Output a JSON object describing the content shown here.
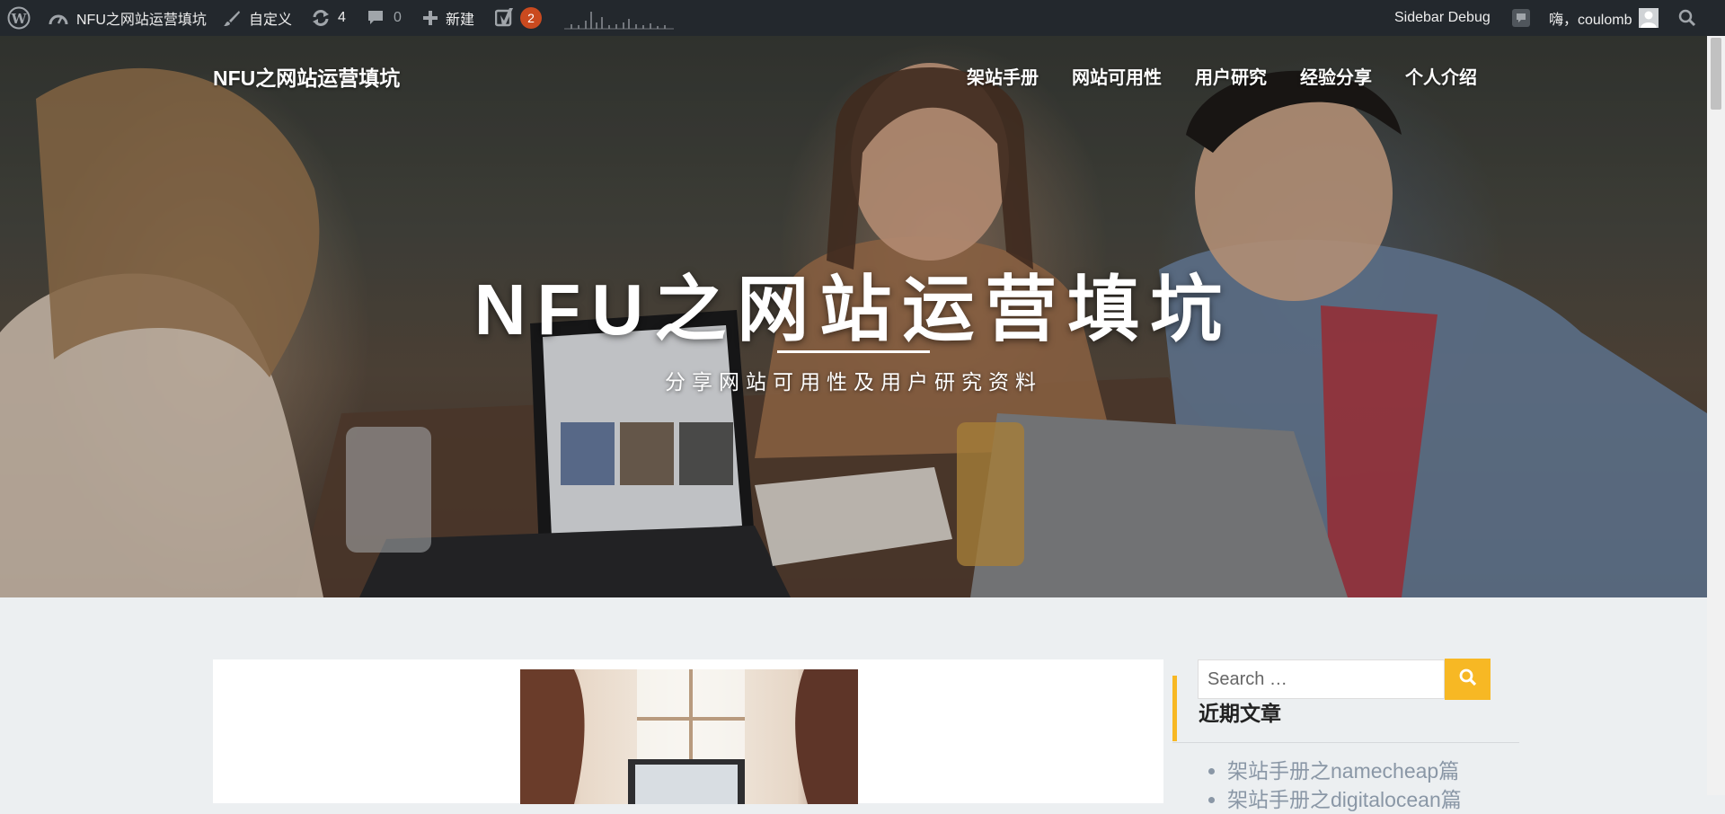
{
  "adminbar": {
    "site_name": "NFU之网站运营填坑",
    "customize": "自定义",
    "updates_count": "4",
    "comments_count": "0",
    "new_label": "新建",
    "yoast_badge": "2",
    "sidebar_debug": "Sidebar Debug",
    "greeting": "嗨，coulomb"
  },
  "header": {
    "site_title": "NFU之网站运营填坑",
    "nav": [
      "架站手册",
      "网站可用性",
      "用户研究",
      "经验分享",
      "个人介绍"
    ]
  },
  "hero": {
    "title": "NFU之网站运营填坑",
    "subtitle": "分享网站可用性及用户研究资料"
  },
  "sidebar": {
    "search_placeholder": "Search …",
    "recent_title": "近期文章",
    "recent_posts": [
      "架站手册之namecheap篇",
      "架站手册之digitalocean篇"
    ]
  },
  "colors": {
    "adminbar_bg": "#23282d",
    "accent": "#f7b824",
    "badge": "#ca4a1f",
    "page_bg": "#eceff1"
  }
}
